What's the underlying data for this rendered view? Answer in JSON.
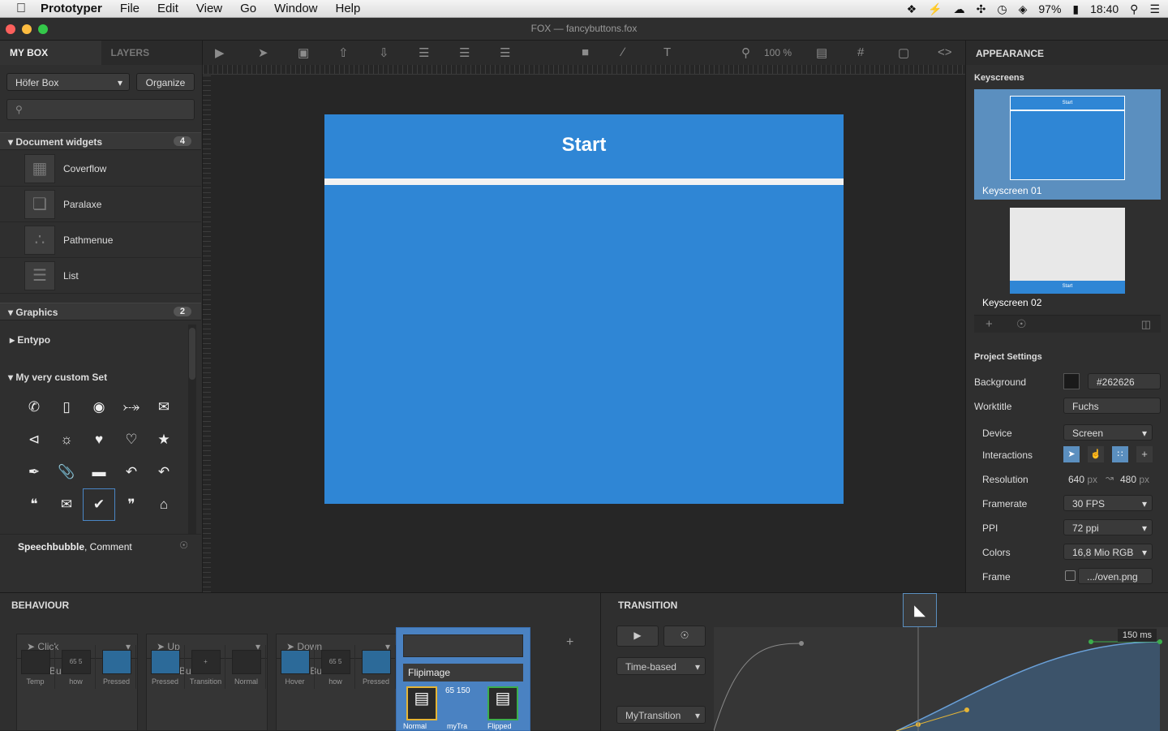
{
  "menubar": {
    "app": "Prototyper",
    "items": [
      "File",
      "Edit",
      "View",
      "Go",
      "Window",
      "Help"
    ],
    "battery": "97%",
    "clock": "18:40"
  },
  "window": {
    "title": "FOX  —  fancybuttons.fox"
  },
  "toolbar": {
    "zoom": "100 %"
  },
  "left": {
    "tabs": [
      "MY BOX",
      "LAYERS"
    ],
    "box_select": "Höfer Box",
    "organize": "Organize",
    "search_placeholder": "",
    "doc_widgets": {
      "title": "Document widgets",
      "count": "4",
      "items": [
        "Coverflow",
        "Paralaxe",
        "Pathmenue",
        "List"
      ]
    },
    "graphics": {
      "title": "Graphics",
      "count": "2"
    },
    "entypo": "Entypo",
    "custom_set": "My very custom Set",
    "footer_bold": "Speechbubble",
    "footer_rest": ", Comment"
  },
  "canvas": {
    "screen_title": "Start"
  },
  "right": {
    "header": "APPEARANCE",
    "keyscreens_label": "Keyscreens",
    "keyscreens": [
      {
        "name": "Keyscreen 01",
        "thumb_title": "Start"
      },
      {
        "name": "Keyscreen 02",
        "thumb_title": "Start"
      }
    ],
    "project_settings": "Project Settings",
    "settings": {
      "background_label": "Background",
      "background_value": "#262626",
      "worktitle_label": "Worktitle",
      "worktitle_value": "Fuchs",
      "device_label": "Device",
      "device_value": "Screen",
      "interactions_label": "Interactions",
      "resolution_label": "Resolution",
      "res_w": "640",
      "res_h": "480",
      "res_unit": "px",
      "framerate_label": "Framerate",
      "framerate_value": "30 FPS",
      "ppi_label": "PPI",
      "ppi_value": "72 ppi",
      "colors_label": "Colors",
      "colors_value": "16,8 Mio RGB",
      "frame_label": "Frame",
      "frame_value": ".../oven.png"
    }
  },
  "behaviour": {
    "header": "BEHAVIOUR",
    "columns": [
      {
        "event": "Click",
        "state": "Enter Button",
        "minis": [
          "Temp",
          "how",
          "Pressed"
        ],
        "num": "5",
        "num2": "65"
      },
      {
        "event": "Up",
        "state": "Enter Button",
        "minis": [
          "Pressed",
          "Transition",
          "Normal"
        ]
      },
      {
        "event": "Down",
        "state": "Show Button",
        "minis": [
          "Hover",
          "how",
          "Pressed"
        ],
        "num": "5",
        "num2": "65"
      }
    ],
    "flip": {
      "title": "Flipimage",
      "minis": [
        "Normal",
        "myTra",
        "Flipped"
      ],
      "num": "150",
      "num2": "65"
    }
  },
  "transition": {
    "header": "TRANSITION",
    "mode": "Time-based",
    "name": "MyTransition",
    "duration": "150 ms"
  },
  "colors": {
    "accent": "#2f86d5",
    "selection": "#5b8fbf"
  }
}
